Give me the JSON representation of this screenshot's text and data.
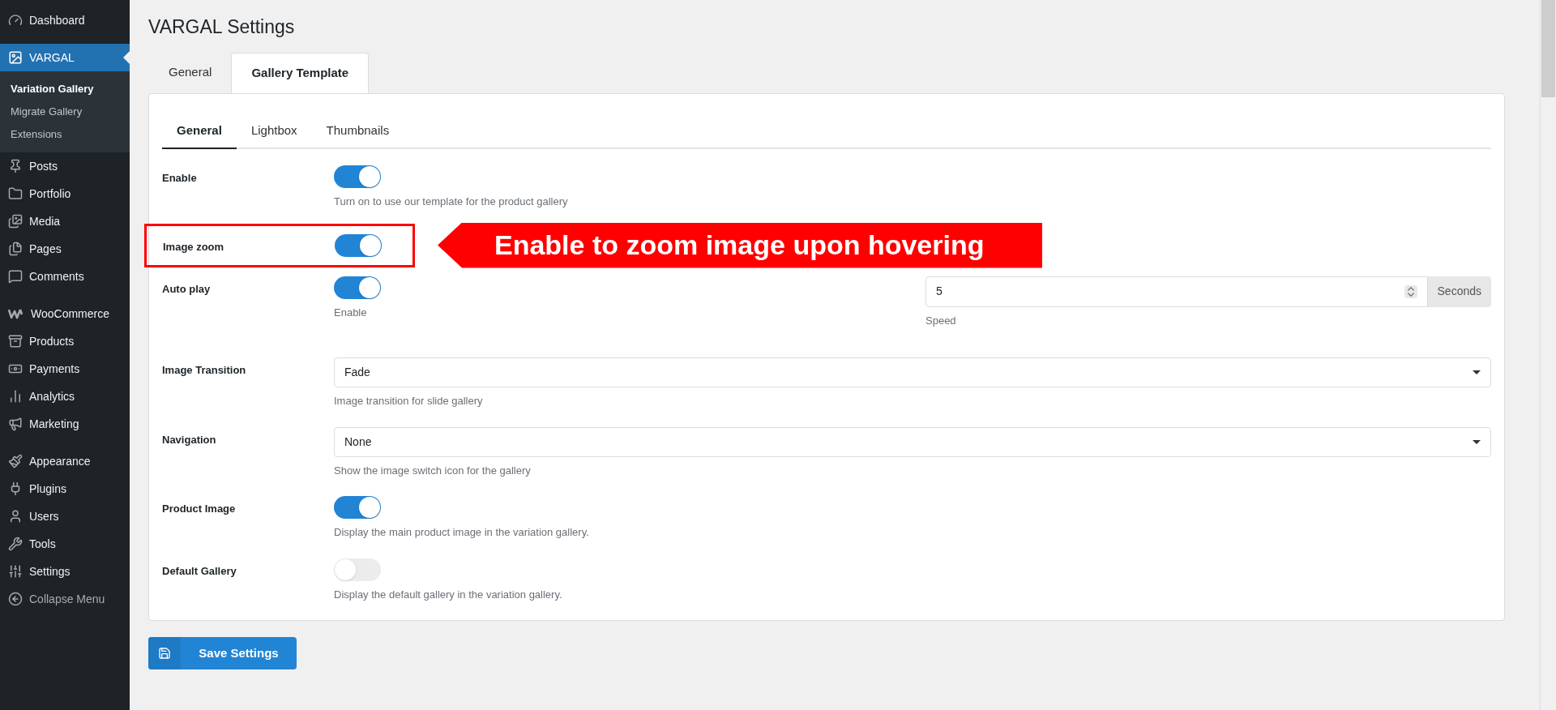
{
  "sidebar": {
    "sections": [
      [
        {
          "label": "Dashboard",
          "selected": false,
          "muted": false
        }
      ],
      [
        {
          "label": "VARGAL",
          "selected": true,
          "muted": false,
          "children": [
            {
              "label": "Variation Gallery",
              "selected": true
            },
            {
              "label": "Migrate Gallery",
              "selected": false
            },
            {
              "label": "Extensions",
              "selected": false
            }
          ]
        }
      ],
      [
        {
          "label": "Posts",
          "selected": false,
          "muted": false
        },
        {
          "label": "Portfolio",
          "selected": false,
          "muted": false
        },
        {
          "label": "Media",
          "selected": false,
          "muted": false
        },
        {
          "label": "Pages",
          "selected": false,
          "muted": false
        },
        {
          "label": "Comments",
          "selected": false,
          "muted": false
        }
      ],
      [
        {
          "label": "WooCommerce",
          "selected": false,
          "muted": false
        },
        {
          "label": "Products",
          "selected": false,
          "muted": false
        },
        {
          "label": "Payments",
          "selected": false,
          "muted": false
        },
        {
          "label": "Analytics",
          "selected": false,
          "muted": false
        },
        {
          "label": "Marketing",
          "selected": false,
          "muted": false
        }
      ],
      [
        {
          "label": "Appearance",
          "selected": false,
          "muted": false
        },
        {
          "label": "Plugins",
          "selected": false,
          "muted": false
        },
        {
          "label": "Users",
          "selected": false,
          "muted": false
        },
        {
          "label": "Tools",
          "selected": false,
          "muted": false
        },
        {
          "label": "Settings",
          "selected": false,
          "muted": false
        },
        {
          "label": "Collapse Menu",
          "selected": false,
          "muted": true
        }
      ]
    ]
  },
  "page_title": "VARGAL Settings",
  "tabs": [
    {
      "label": "General",
      "selected": false
    },
    {
      "label": "Gallery Template",
      "selected": true
    }
  ],
  "subtabs": [
    {
      "label": "General",
      "selected": true
    },
    {
      "label": "Lightbox",
      "selected": false
    },
    {
      "label": "Thumbnails",
      "selected": false
    }
  ],
  "settings": [
    {
      "kind": "toggle",
      "label": "Enable",
      "on": true,
      "help": "Turn on to use our template for the product gallery",
      "highlighted": false
    },
    {
      "kind": "toggle",
      "label": "Image zoom",
      "on": true,
      "highlighted": true
    },
    {
      "kind": "toggle_number",
      "label": "Auto play",
      "on": true,
      "help": "Enable",
      "value": "5",
      "unit": "Seconds",
      "field_help": "Speed",
      "highlighted": false
    },
    {
      "kind": "select",
      "label": "Image Transition",
      "value": "Fade",
      "help": "Image transition for slide gallery",
      "highlighted": false
    },
    {
      "kind": "select",
      "label": "Navigation",
      "value": "None",
      "help": "Show the image switch icon for the gallery",
      "highlighted": false
    },
    {
      "kind": "toggle",
      "label": "Product Image",
      "on": true,
      "help": "Display the main product image in the variation gallery.",
      "highlighted": false
    },
    {
      "kind": "toggle",
      "label": "Default Gallery",
      "on": false,
      "help": "Display the default gallery in the variation gallery.",
      "highlighted": false
    }
  ],
  "annotation": {
    "text": "Enable to zoom image upon hovering"
  },
  "save_button": {
    "label": "Save Settings"
  }
}
